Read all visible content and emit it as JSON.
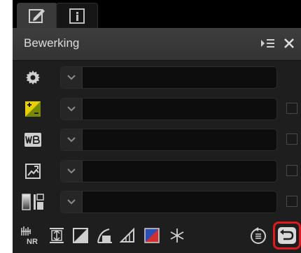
{
  "tabs": [
    {
      "icon": "edit-pencil-icon"
    },
    {
      "icon": "info-icon"
    }
  ],
  "header": {
    "title": "Bewerking",
    "menu_icon": "panel-menu-icon",
    "close_icon": "close-icon"
  },
  "rows": [
    {
      "icon": "gear-icon",
      "value": "",
      "has_checkbox": false
    },
    {
      "icon": "exposure-compensation-icon",
      "value": "",
      "has_checkbox": true
    },
    {
      "icon": "white-balance-icon",
      "value": "",
      "has_checkbox": true
    },
    {
      "icon": "picture-control-icon",
      "value": "",
      "has_checkbox": true
    },
    {
      "icon": "tone-levels-icon",
      "value": "",
      "has_checkbox": true
    }
  ],
  "toolbar": {
    "tools": [
      "noise-reduction-icon",
      "crop-icon",
      "levels-curves-icon",
      "lch-icon",
      "distortion-icon",
      "color-balance-icon",
      "retouch-brush-icon",
      "step-list-icon",
      "revert-icon"
    ],
    "nr_label": "NR"
  },
  "colors": {
    "panel": "#1e1e1e",
    "header": "#383838",
    "accent_yellow": "#e8d000",
    "highlight": "#e0191f"
  }
}
